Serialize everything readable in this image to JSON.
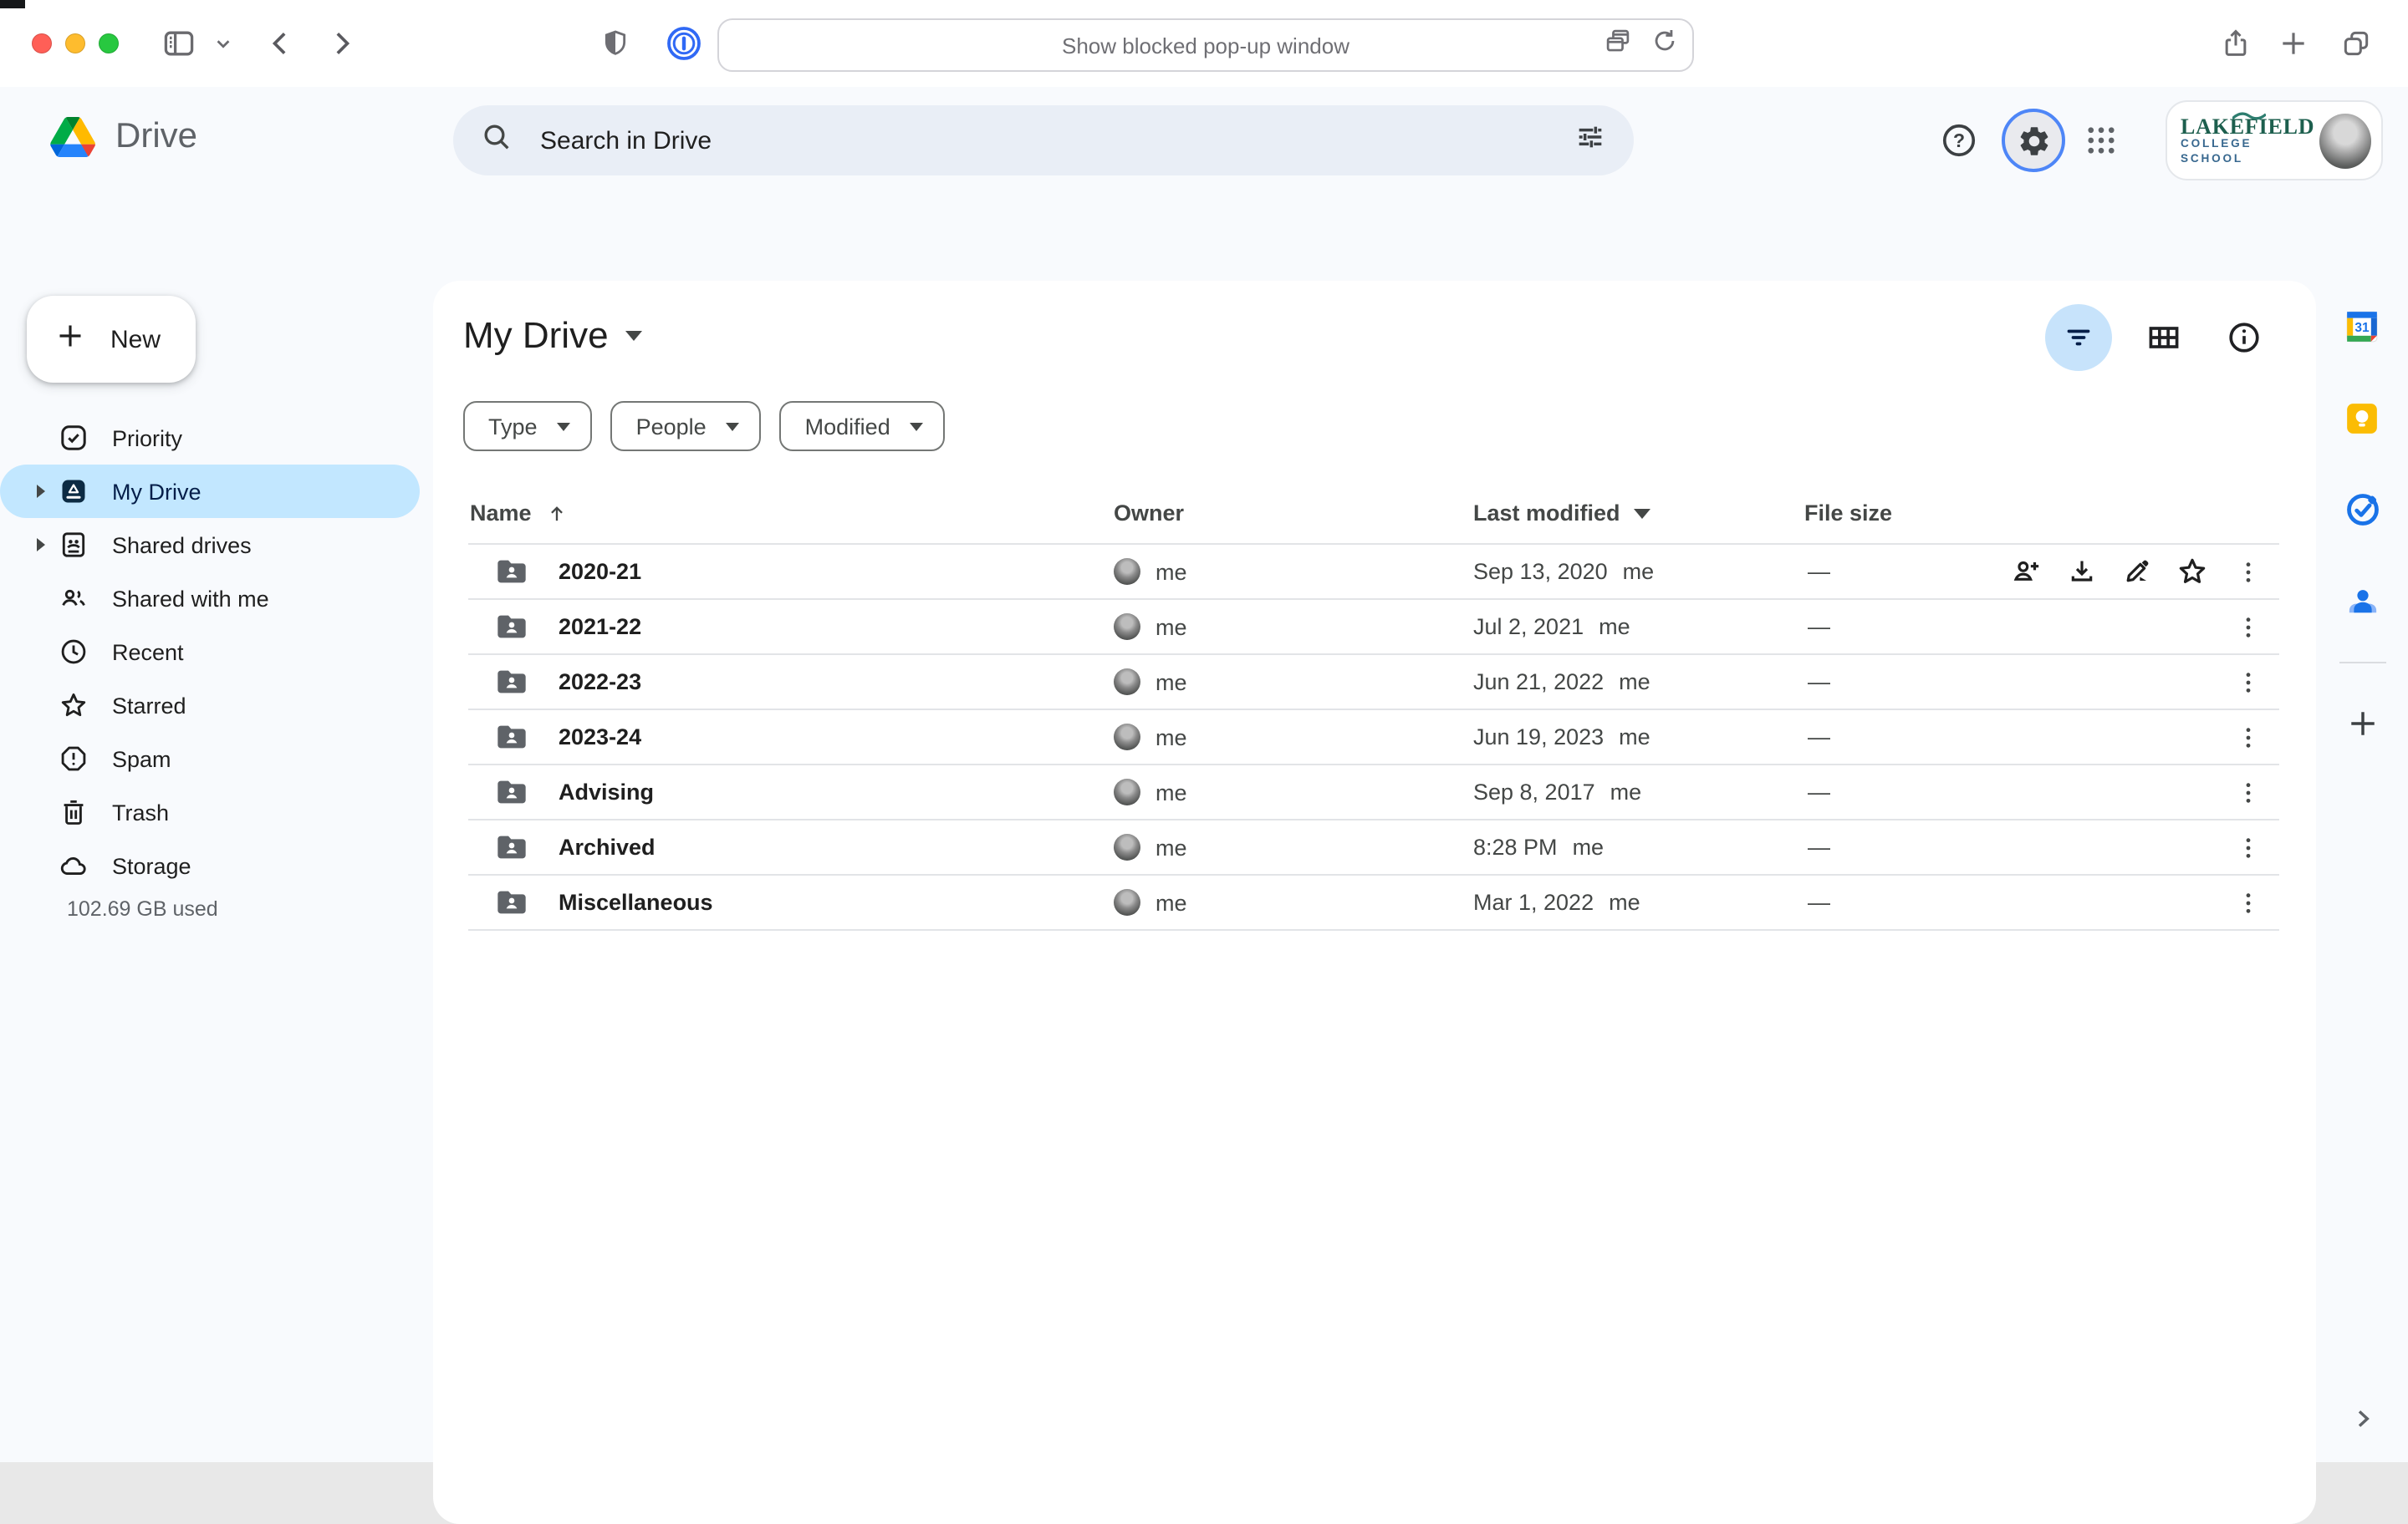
{
  "browser": {
    "address_text": "Show blocked pop-up window"
  },
  "drive_header": {
    "product_name": "Drive",
    "search_placeholder": "Search in Drive",
    "account": {
      "org_line1": "LAKEFIELD",
      "org_line2": "COLLEGE SCHOOL"
    }
  },
  "sidebar": {
    "new_label": "New",
    "items": [
      {
        "label": "Priority"
      },
      {
        "label": "My Drive",
        "selected": true
      },
      {
        "label": "Shared drives"
      },
      {
        "label": "Shared with me"
      },
      {
        "label": "Recent"
      },
      {
        "label": "Starred"
      },
      {
        "label": "Spam"
      },
      {
        "label": "Trash"
      },
      {
        "label": "Storage"
      }
    ],
    "storage_used": "102.69 GB used"
  },
  "main": {
    "title": "My Drive",
    "filter_chips": [
      {
        "label": "Type"
      },
      {
        "label": "People"
      },
      {
        "label": "Modified"
      }
    ],
    "table": {
      "columns": {
        "name": "Name",
        "owner": "Owner",
        "modified": "Last modified",
        "size": "File size"
      },
      "rows": [
        {
          "name": "2020-21",
          "owner": "me",
          "modified": "Sep 13, 2020",
          "modified_by": "me",
          "size": "—",
          "hovered": true
        },
        {
          "name": "2021-22",
          "owner": "me",
          "modified": "Jul 2, 2021",
          "modified_by": "me",
          "size": "—"
        },
        {
          "name": "2022-23",
          "owner": "me",
          "modified": "Jun 21, 2022",
          "modified_by": "me",
          "size": "—"
        },
        {
          "name": "2023-24",
          "owner": "me",
          "modified": "Jun 19, 2023",
          "modified_by": "me",
          "size": "—"
        },
        {
          "name": "Advising",
          "owner": "me",
          "modified": "Sep 8, 2017",
          "modified_by": "me",
          "size": "—"
        },
        {
          "name": "Archived",
          "owner": "me",
          "modified": "8:28 PM",
          "modified_by": "me",
          "size": "—"
        },
        {
          "name": "Miscellaneous",
          "owner": "me",
          "modified": "Mar 1, 2022",
          "modified_by": "me",
          "size": "—"
        }
      ]
    }
  },
  "colors": {
    "selected_pill": "#c2e7ff",
    "folder_gray": "#5f6368",
    "keep_yellow": "#fbbc04",
    "google_blue": "#1a73e8",
    "lakefield_green": "#1d5f4e",
    "lakefield_blue": "#38688f"
  }
}
